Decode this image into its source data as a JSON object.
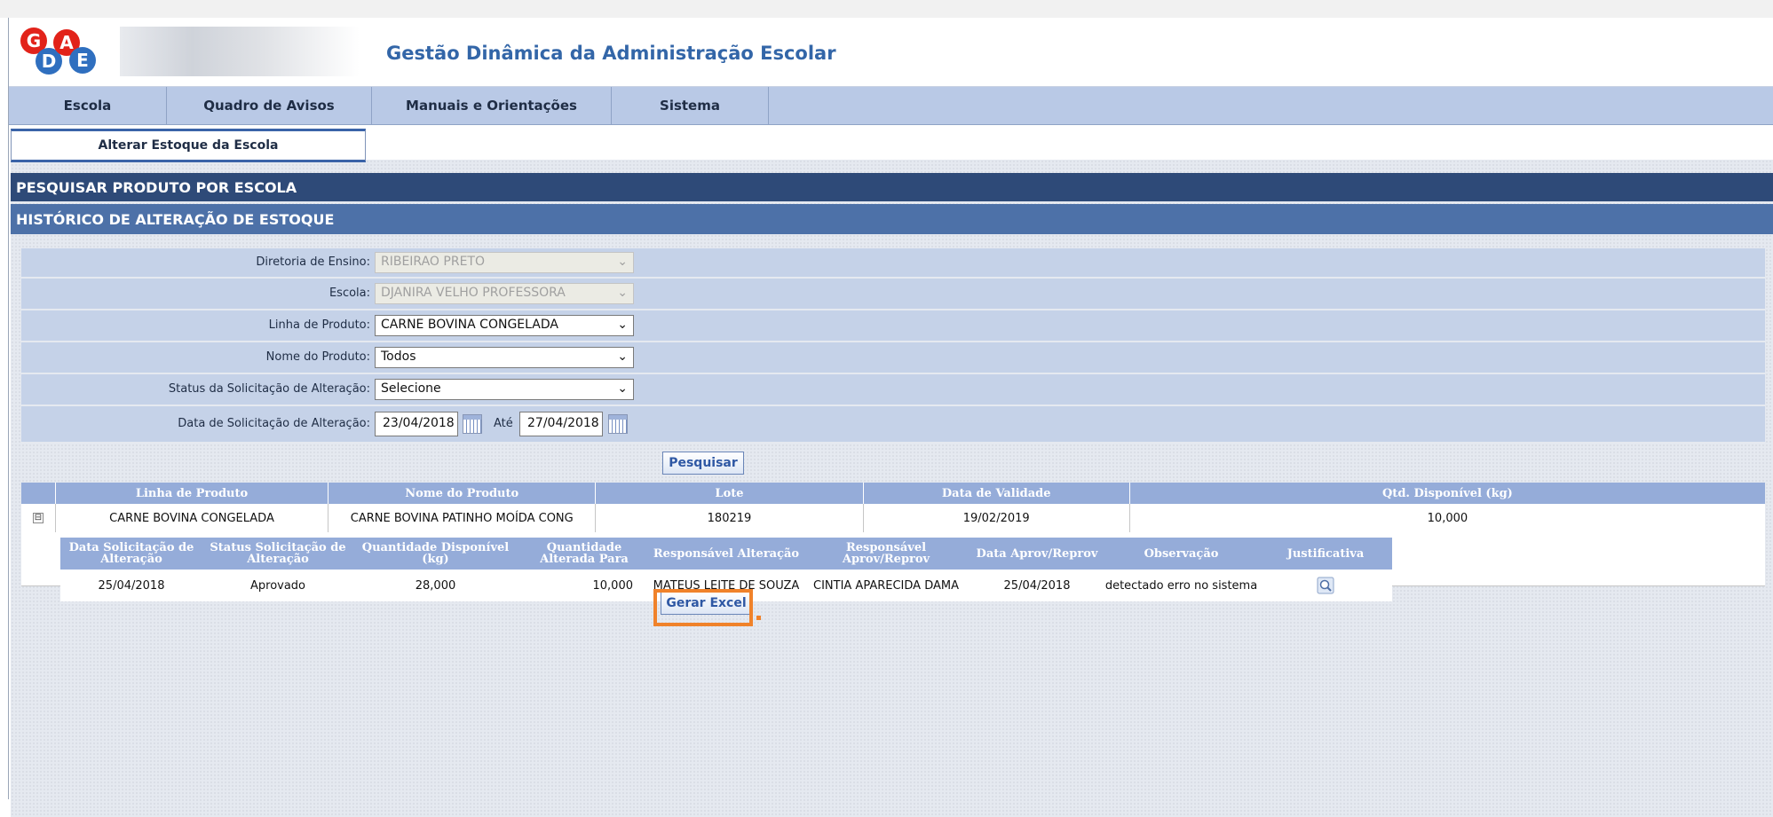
{
  "header": {
    "title": "Gestão Dinâmica da Administração Escolar",
    "logo_text": "GDAE"
  },
  "nav": {
    "items": [
      {
        "label": "Escola"
      },
      {
        "label": "Quadro de Avisos"
      },
      {
        "label": "Manuais e Orientações"
      },
      {
        "label": "Sistema"
      }
    ]
  },
  "tab": {
    "label": "Alterar Estoque da Escola"
  },
  "sections": {
    "search": "PESQUISAR PRODUTO POR ESCOLA",
    "history": "HISTÓRICO DE ALTERAÇÃO DE ESTOQUE"
  },
  "form": {
    "diretoria": {
      "label": "Diretoria de Ensino:",
      "value": "RIBEIRAO PRETO"
    },
    "escola": {
      "label": "Escola:",
      "value": "DJANIRA VELHO PROFESSORA"
    },
    "linha": {
      "label": "Linha de Produto:",
      "value": "CARNE BOVINA CONGELADA"
    },
    "nome": {
      "label": "Nome do Produto:",
      "value": "Todos"
    },
    "status": {
      "label": "Status da Solicitação de Alteração:",
      "value": "Selecione"
    },
    "data": {
      "label": "Data de Solicitação de Alteração:",
      "from": "23/04/2018",
      "to_label": "Até",
      "to": "27/04/2018"
    },
    "search_button": "Pesquisar"
  },
  "results": {
    "columns": [
      "Linha de Produto",
      "Nome do Produto",
      "Lote",
      "Data de Validade",
      "Qtd. Disponível (kg)"
    ],
    "row": {
      "expander": "⊟",
      "linha": "CARNE BOVINA CONGELADA",
      "nome": "CARNE BOVINA PATINHO MOÍDA CONG",
      "lote": "180219",
      "validade": "19/02/2019",
      "qtd": "10,000"
    },
    "sub_columns": [
      "Data Solicitação de Alteração",
      "Status Solicitação de Alteração",
      "Quantidade Disponível (kg)",
      "Quantidade Alterada Para",
      "Responsável Alteração",
      "Responsável Aprov/Reprov",
      "Data Aprov/Reprov",
      "Observação",
      "Justificativa"
    ],
    "sub_row": {
      "data": "25/04/2018",
      "status": "Aprovado",
      "qtd_disp": "28,000",
      "qtd_alt": "10,000",
      "resp": "MATEUS LEITE DE SOUZA",
      "resp_aprov": "CINTIA APARECIDA DAMA",
      "data_aprov": "25/04/2018",
      "obs": "detectado erro no sistema"
    }
  },
  "export_button": "Gerar Excel",
  "colors": {
    "nav": "#b9c9e6",
    "bar_dark": "#2e4a78",
    "bar_mid": "#4d71a8",
    "table_head": "#95acd9",
    "highlight": "#f0822a",
    "title": "#3366a8"
  }
}
